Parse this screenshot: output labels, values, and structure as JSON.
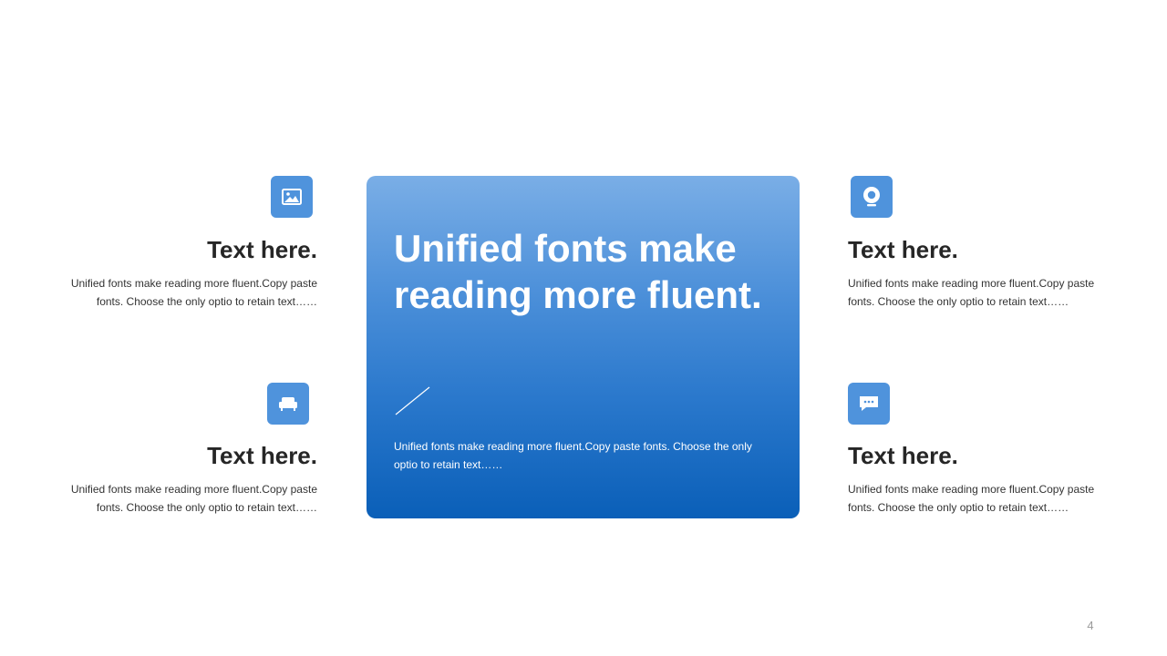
{
  "slide": {
    "accent_color": "#4f93dc",
    "card_gradient": [
      "#7aaee6",
      "#0a5fb8"
    ],
    "page_number": "4"
  },
  "center_card": {
    "headline": "Unified fonts make reading more fluent.",
    "body": "Unified fonts make reading more fluent.Copy paste fonts. Choose the only optio to retain text……"
  },
  "blocks": [
    {
      "icon": "image-icon",
      "title": "Text here.",
      "body": "Unified fonts make reading more fluent.Copy paste fonts. Choose the only optio to retain text……"
    },
    {
      "icon": "sofa-icon",
      "title": "Text here.",
      "body": "Unified fonts make reading more fluent.Copy paste fonts. Choose the only optio to retain text……"
    },
    {
      "icon": "webcam-icon",
      "title": "Text here.",
      "body": "Unified fonts make reading more fluent.Copy paste fonts. Choose the only optio to retain text……"
    },
    {
      "icon": "chat-bubble-icon",
      "title": "Text here.",
      "body": "Unified fonts make reading more fluent.Copy paste fonts. Choose the only optio to retain text……"
    }
  ]
}
